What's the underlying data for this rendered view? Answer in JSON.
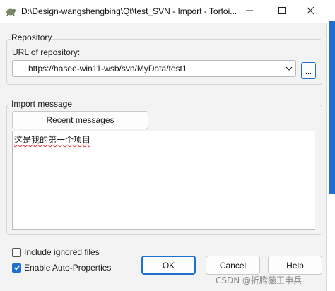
{
  "window": {
    "title": "D:\\Design-wangshengbing\\Qt\\test_SVN - Import - Tortoi..."
  },
  "repository": {
    "group_label": "Repository",
    "url_label": "URL of repository:",
    "url_value": "https://hasee-win11-wsb/svn/MyData/test1",
    "browse_label": "..."
  },
  "import_message": {
    "group_label": "Import message",
    "recent_messages_label": "Recent messages",
    "message_text": "这是我的第一个项目"
  },
  "options": {
    "include_ignored_label": "Include ignored files",
    "include_ignored_checked": false,
    "auto_props_label": "Enable Auto-Properties",
    "auto_props_checked": true
  },
  "buttons": {
    "ok_label": "OK",
    "cancel_label": "Cancel",
    "help_label": "Help"
  },
  "watermark": "CSDN @折腾猿王申兵",
  "colors": {
    "accent": "#1f6fd1",
    "spellcheck": "#e03030"
  }
}
